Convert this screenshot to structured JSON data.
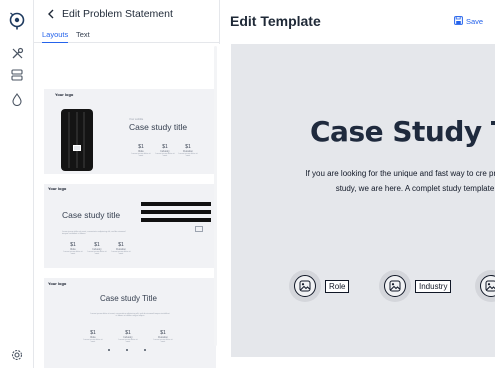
{
  "panel": {
    "title": "Edit Problem Statement",
    "tabs": [
      "Layouts",
      "Text"
    ]
  },
  "thumbs": [
    {
      "logo": "Your logo",
      "subtitle": "Your subtitle",
      "title": "Case study title",
      "stats": [
        {
          "n": "$1",
          "l": "Role",
          "d": "Lorem ipsum dolor sit amet"
        },
        {
          "n": "$1",
          "l": "Industry",
          "d": "Lorem ipsum dolor sit amet"
        },
        {
          "n": "$1",
          "l": "Duration",
          "d": "Lorem ipsum dolor sit amet"
        }
      ]
    },
    {
      "logo": "Your logo",
      "title": "Case study title",
      "body": "Lorem ipsum dolor sit amet, consectetur adipiscing elit, sed do eiusmod tempor incididunt ut labore",
      "stats": [
        {
          "n": "$1",
          "l": "Role",
          "d": "Lorem ipsum dolor sit amet"
        },
        {
          "n": "$1",
          "l": "Industry",
          "d": "Lorem ipsum dolor sit amet"
        },
        {
          "n": "$1",
          "l": "Duration",
          "d": "Lorem ipsum dolor sit amet"
        }
      ]
    },
    {
      "logo": "Your logo",
      "title": "Case study Title",
      "body": "Lorem ipsum dolor sit amet, consectetur adipiscing elit, sed do eiusmod tempor incididunt ut labore et dolore magna aliqua",
      "stats": [
        {
          "n": "$1",
          "l": "Role",
          "d": "Lorem ipsum dolor sit amet"
        },
        {
          "n": "$1",
          "l": "Industry",
          "d": "Lorem ipsum dolor sit amet"
        },
        {
          "n": "$1",
          "l": "Duration",
          "d": "Lorem ipsum dolor sit amet"
        }
      ]
    }
  ],
  "editor": {
    "title": "Edit Template",
    "save_label": "Save"
  },
  "preview": {
    "title": "Case Study Tit",
    "description": "If you are looking for the unique and fast way to cre present your case study, we are here. A complet study template builder.",
    "tags": [
      "Role",
      "Industry"
    ]
  },
  "colors": {
    "accent": "#2563eb",
    "stage": "#e5e7eb",
    "thumb_bg": "#f1f2f5"
  },
  "icons": {
    "rail": [
      "logo-icon",
      "tools-icon",
      "layers-icon",
      "drop-icon",
      "settings-icon"
    ]
  }
}
